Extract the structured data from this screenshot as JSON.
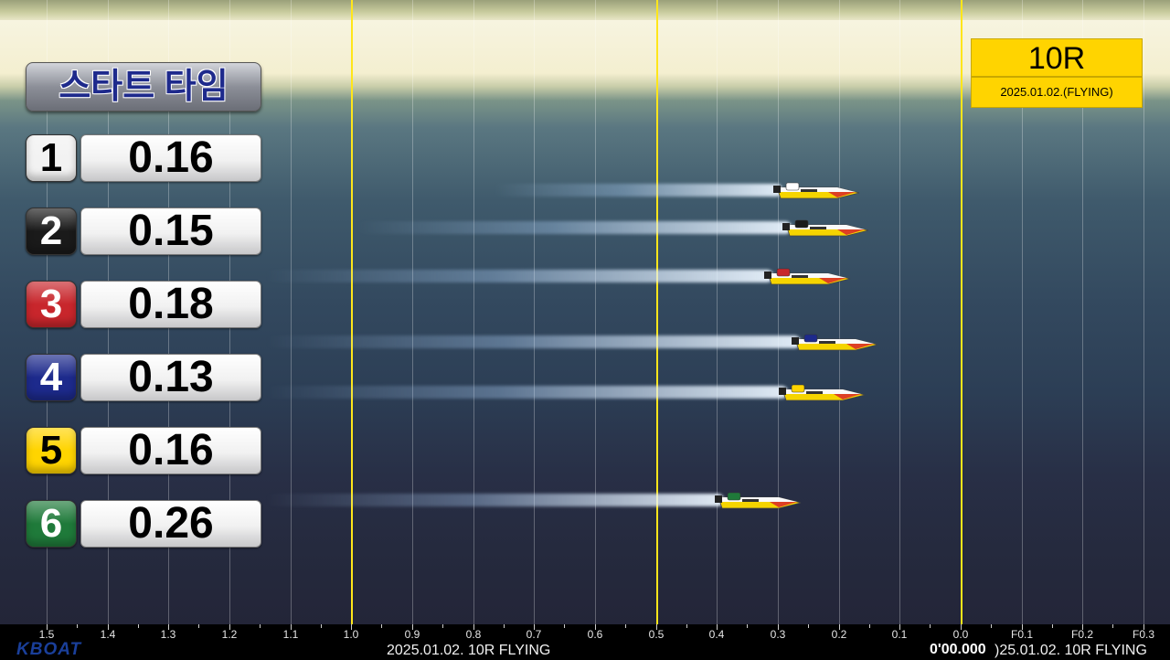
{
  "title": "스타트 타임",
  "race": {
    "number": "10R",
    "date_label": "2025.01.02.(FLYING)"
  },
  "lanes": [
    {
      "lane": "1",
      "time": "0.16",
      "badge_color": "#f2f2f2",
      "text_color": "#000000"
    },
    {
      "lane": "2",
      "time": "0.15",
      "badge_color": "#1a1a1a",
      "text_color": "#ffffff"
    },
    {
      "lane": "3",
      "time": "0.18",
      "badge_color": "#c8262c",
      "text_color": "#ffffff"
    },
    {
      "lane": "4",
      "time": "0.13",
      "badge_color": "#1d2a8c",
      "text_color": "#ffffff"
    },
    {
      "lane": "5",
      "time": "0.16",
      "badge_color": "#ffd400",
      "text_color": "#000000"
    },
    {
      "lane": "6",
      "time": "0.26",
      "badge_color": "#1f7a3a",
      "text_color": "#ffffff"
    }
  ],
  "axis_ticks": [
    "1.5",
    "1.4",
    "1.3",
    "1.2",
    "1.1",
    "1.0",
    "0.9",
    "0.8",
    "0.7",
    "0.6",
    "0.5",
    "0.4",
    "0.3",
    "0.2",
    "0.1",
    "0.0",
    "F0.1",
    "F0.2",
    "F0.3"
  ],
  "bottom_left_logo": "KBOAT",
  "bottom_center_text": "2025.01.02. 10R FLYING",
  "bottom_timer": "0'00.000",
  "bottom_right_text": ")25.01.02. 10R FLYING",
  "boat_colors": [
    "#ffffff",
    "#1a1a1a",
    "#c8262c",
    "#1d2a8c",
    "#ffd400",
    "#1f7a3a"
  ]
}
